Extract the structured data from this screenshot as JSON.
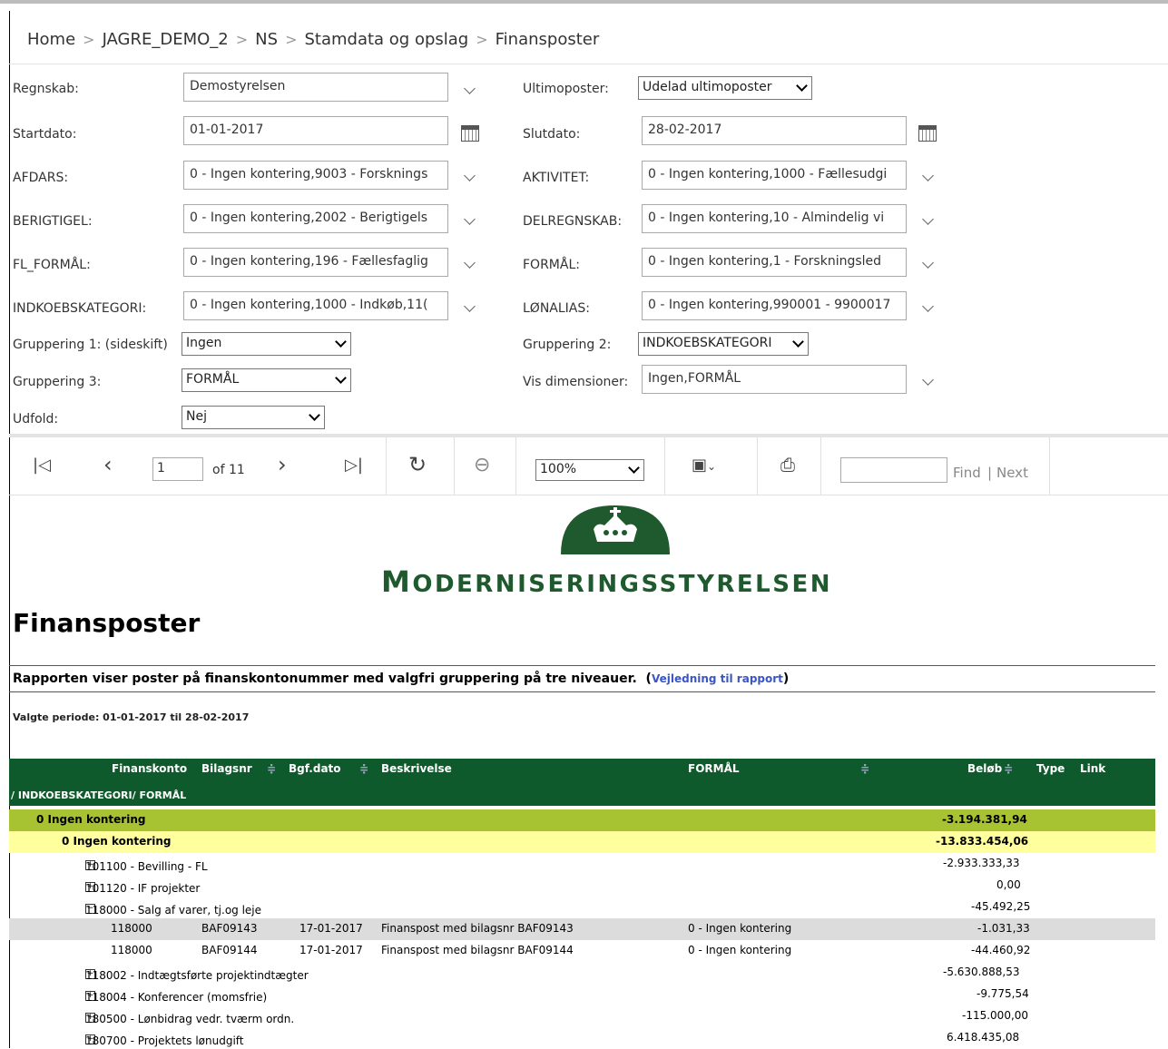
{
  "breadcrumb": [
    "Home",
    "JAGRE_DEMO_2",
    "NS",
    "Stamdata og opslag",
    "Finansposter"
  ],
  "form": {
    "regnskab": {
      "label": "Regnskab:",
      "value": "Demostyrelsen"
    },
    "ultimoposter": {
      "label": "Ultimoposter:",
      "value": "Udelad ultimoposter"
    },
    "startdato": {
      "label": "Startdato:",
      "value": "01-01-2017"
    },
    "slutdato": {
      "label": "Slutdato:",
      "value": "28-02-2017"
    },
    "afdars": {
      "label": "AFDARS:",
      "value": "0 - Ingen kontering,9003 - Forsknings"
    },
    "aktivitet": {
      "label": "AKTIVITET:",
      "value": "0 - Ingen kontering,1000 - Fællesudgi"
    },
    "berigtigel": {
      "label": "BERIGTIGEL:",
      "value": "0 - Ingen kontering,2002 - Berigtigels"
    },
    "delregnskab": {
      "label": "DELREGNSKAB:",
      "value": "0 - Ingen kontering,10 - Almindelig vi"
    },
    "fl_formaal": {
      "label": "FL_FORMÅL:",
      "value": "0 - Ingen kontering,196 - Fællesfaglig"
    },
    "formaal": {
      "label": "FORMÅL:",
      "value": "0 - Ingen kontering,1 - Forskningsled"
    },
    "indkoebskategori": {
      "label": "INDKOEBSKATEGORI:",
      "value": "0 - Ingen kontering,1000 - Indkøb,11("
    },
    "loenalias": {
      "label": "LØNALIAS:",
      "value": "0 - Ingen kontering,990001 - 9900017"
    },
    "gruppering1": {
      "label": "Gruppering 1: (sideskift)",
      "value": "Ingen"
    },
    "gruppering2": {
      "label": "Gruppering 2:",
      "value": "INDKOEBSKATEGORI"
    },
    "gruppering3": {
      "label": "Gruppering 3:",
      "value": "FORMÅL"
    },
    "vis_dimensioner": {
      "label": "Vis dimensioner:",
      "value": "Ingen,FORMÅL"
    },
    "udfold": {
      "label": "Udfold:",
      "value": "Nej"
    }
  },
  "toolbar": {
    "page_value": "1",
    "page_of": "of 11",
    "zoom": "100%",
    "find_label": "Find",
    "next_label": "Next",
    "find_sep": "|"
  },
  "report": {
    "logo_text_big": "M",
    "logo_text_rest": "ODERNISERINGSSTYRELSEN",
    "title": "Finansposter",
    "description": "Rapporten viser poster på finanskontonummer med valgfri gruppering på tre niveauer.",
    "link_label": "Vejledning til rapport",
    "period": "Valgte periode: 01-01-2017 til 28-02-2017",
    "columns": {
      "finanskonto": "Finanskonto",
      "bilagsnr": "Bilagsnr",
      "bgf_dato": "Bgf.dato",
      "beskrivelse": "Beskrivelse",
      "formaal": "FORMÅL",
      "beloeb": "Beløb",
      "type": "Type",
      "link": "Link"
    },
    "group_header": "/ INDKOEBSKATEGORI/ FORMÅL",
    "rows": [
      {
        "kind": "group1",
        "label": "0  Ingen kontering",
        "amount": "-3.194.381,94"
      },
      {
        "kind": "group2",
        "label": "0  Ingen kontering",
        "amount": "-13.833.454,06"
      },
      {
        "kind": "account",
        "label": "101100 - Bevilling - FL",
        "amount": "-2.933.333,33"
      },
      {
        "kind": "account",
        "label": "101120 - IF projekter",
        "amount": "0,00"
      },
      {
        "kind": "account-open",
        "label": "118000 - Salg af varer, tj.og leje",
        "amount": "-45.492,25"
      },
      {
        "kind": "detail",
        "konto": "118000",
        "bilag": "BAF09143",
        "dato": "17-01-2017",
        "beskrivelse": "Finanspost med bilagsnr BAF09143",
        "formaal": "0 - Ingen kontering",
        "amount": "-1.031,33"
      },
      {
        "kind": "detail-white",
        "konto": "118000",
        "bilag": "BAF09144",
        "dato": "17-01-2017",
        "beskrivelse": "Finanspost med bilagsnr BAF09144",
        "formaal": "0 - Ingen kontering",
        "amount": "-44.460,92"
      },
      {
        "kind": "account",
        "label": "118002 - Indtægtsførte projektindtægter",
        "amount": "-5.630.888,53"
      },
      {
        "kind": "account",
        "label": "118004 - Konferencer (momsfrie)",
        "amount": "-9.775,54"
      },
      {
        "kind": "account",
        "label": "180500 - Lønbidrag vedr. tværm ordn.",
        "amount": "-115.000,00"
      },
      {
        "kind": "account",
        "label": "180700 - Projektets lønudgift",
        "amount": "6.418.435,08"
      }
    ]
  },
  "colors": {
    "header_green": "#0f5a2d",
    "group1": "#a8c332",
    "group2": "#ffff9e",
    "detail_grey": "#dcdcdc",
    "logo_green": "#1e5a2e"
  }
}
